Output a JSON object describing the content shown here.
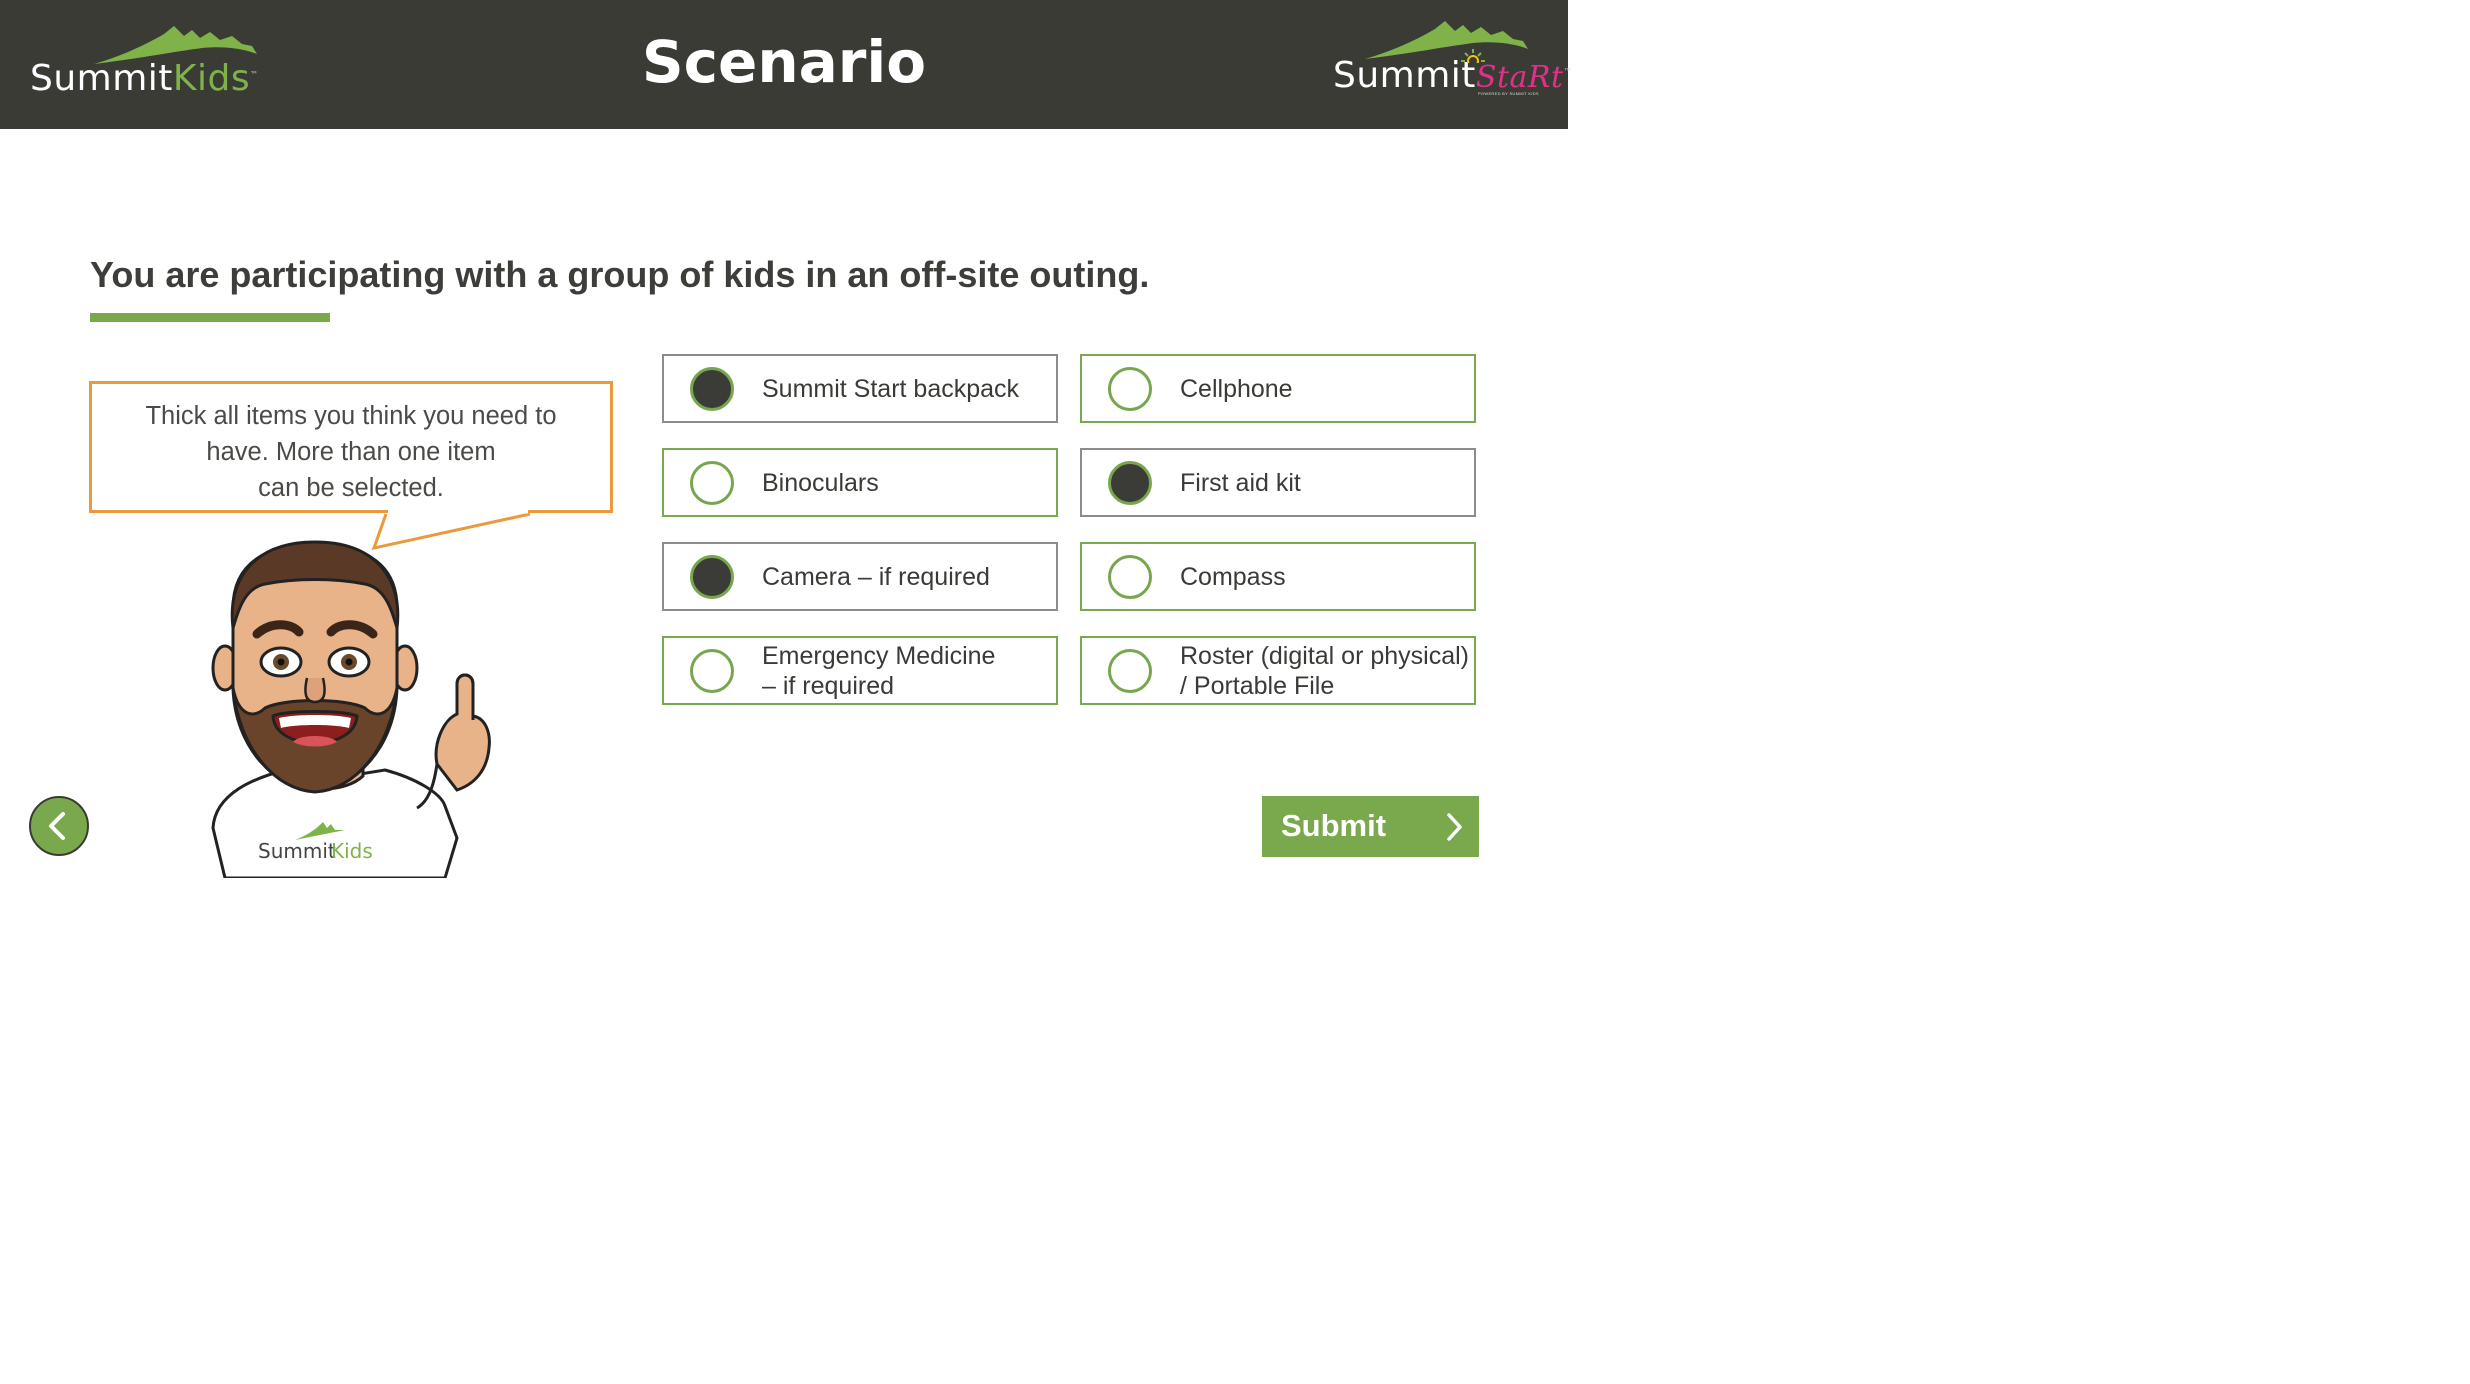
{
  "header": {
    "title": "Scenario",
    "logo_left": {
      "summit": "Summit",
      "kids": "Kids",
      "tm": "™"
    },
    "logo_right": {
      "summit": "Summit",
      "start": "StaRt",
      "tm": "™",
      "powered": "POWERED BY SUMMIT KIDS"
    }
  },
  "question": {
    "text": "You are participating with a group of kids in an off-site outing."
  },
  "instruction": {
    "line1": "Thick all items you think you need to",
    "line2": "have. More than one item",
    "line3": "can be selected."
  },
  "avatar": {
    "shirt_summit": "Summit",
    "shirt_kids": "Kids"
  },
  "options": [
    {
      "label": "Summit Start backpack",
      "selected": true
    },
    {
      "label": "Cellphone",
      "selected": false
    },
    {
      "label": "Binoculars",
      "selected": false
    },
    {
      "label": "First aid kit",
      "selected": true
    },
    {
      "label": "Camera – if required",
      "selected": true
    },
    {
      "label": "Compass",
      "selected": false
    },
    {
      "label_line1": "Emergency Medicine",
      "label_line2": "– if required",
      "selected": false
    },
    {
      "label_line1": "Roster (digital or physical)",
      "label_line2": "/ Portable File",
      "selected": false
    }
  ],
  "buttons": {
    "submit": "Submit"
  },
  "colors": {
    "header_bg": "#3b3b36",
    "accent_green": "#7aa84e",
    "bubble_border": "#ea9a3a",
    "start_pink": "#e0318a"
  },
  "icons": {
    "back": "chevron-left-icon",
    "submit": "chevron-right-icon"
  }
}
